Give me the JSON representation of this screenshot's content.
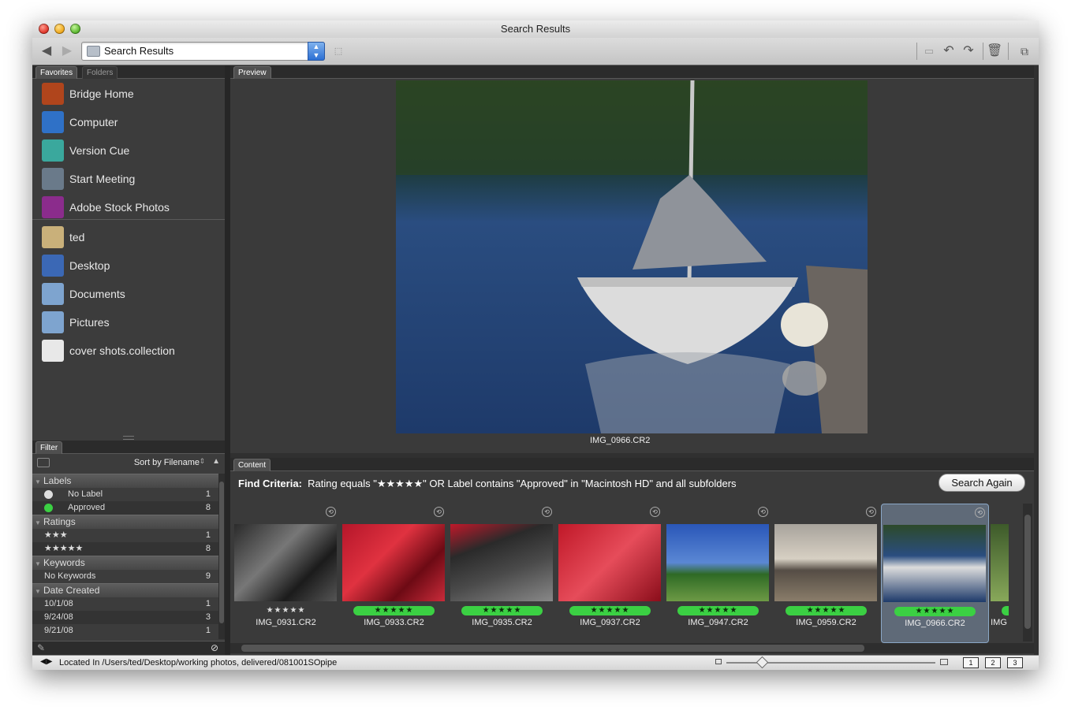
{
  "window": {
    "title": "Search Results"
  },
  "toolbar": {
    "path": "Search Results"
  },
  "left_tabs": {
    "favorites": "Favorites",
    "folders": "Folders"
  },
  "favorites": [
    {
      "label": "Bridge Home",
      "icon": "bridge-home-icon",
      "color": "#b0451c"
    },
    {
      "label": "Computer",
      "icon": "computer-icon",
      "color": "#2f71c7"
    },
    {
      "label": "Version Cue",
      "icon": "version-cue-icon",
      "color": "#3aa89d"
    },
    {
      "label": "Start Meeting",
      "icon": "start-meeting-icon",
      "color": "#6a7a8a"
    },
    {
      "label": "Adobe Stock Photos",
      "icon": "adobe-stock-photos-icon",
      "color": "#8b2c8c"
    },
    {
      "label": "ted",
      "icon": "home-folder-icon",
      "color": "#c9b07a"
    },
    {
      "label": "Desktop",
      "icon": "desktop-folder-icon",
      "color": "#3b68b5"
    },
    {
      "label": "Documents",
      "icon": "documents-folder-icon",
      "color": "#7ea4cf"
    },
    {
      "label": "Pictures",
      "icon": "pictures-folder-icon",
      "color": "#7ea4cf"
    },
    {
      "label": "cover shots.collection",
      "icon": "collection-icon",
      "color": "#e8e8e8"
    }
  ],
  "filter": {
    "tab": "Filter",
    "sort": "Sort by Filename",
    "groups": [
      {
        "name": "Labels",
        "rows": [
          {
            "label": "No Label",
            "count": "1"
          },
          {
            "label": "Approved",
            "count": "8"
          }
        ]
      },
      {
        "name": "Ratings",
        "rows": [
          {
            "label": "★★★",
            "count": "1"
          },
          {
            "label": "★★★★★",
            "count": "8"
          }
        ]
      },
      {
        "name": "Keywords",
        "rows": [
          {
            "label": "No Keywords",
            "count": "9"
          }
        ]
      },
      {
        "name": "Date Created",
        "rows": [
          {
            "label": "10/1/08",
            "count": "1"
          },
          {
            "label": "9/24/08",
            "count": "3"
          },
          {
            "label": "9/21/08",
            "count": "1"
          }
        ]
      }
    ]
  },
  "preview": {
    "tab": "Preview",
    "caption": "IMG_0966.CR2"
  },
  "content": {
    "tab": "Content",
    "criteria_label": "Find Criteria:",
    "criteria_text": "Rating equals \"★★★★★\" OR Label contains \"Approved\" in \"Macintosh HD\" and all subfolders",
    "search_again": "Search Again",
    "thumbs": [
      {
        "name": "IMG_0931.CR2",
        "rating": "★★★★★",
        "approved": false
      },
      {
        "name": "IMG_0933.CR2",
        "rating": "★★★★★",
        "approved": true
      },
      {
        "name": "IMG_0935.CR2",
        "rating": "★★★★★",
        "approved": true
      },
      {
        "name": "IMG_0937.CR2",
        "rating": "★★★★★",
        "approved": true
      },
      {
        "name": "IMG_0947.CR2",
        "rating": "★★★★★",
        "approved": true
      },
      {
        "name": "IMG_0959.CR2",
        "rating": "★★★★★",
        "approved": true
      },
      {
        "name": "IMG_0966.CR2",
        "rating": "★★★★★",
        "approved": true
      },
      {
        "name": "IMG",
        "rating": "★★",
        "approved": true
      }
    ]
  },
  "status": {
    "location": "Located In /Users/ted/Desktop/working photos, delivered/081001SOpipe",
    "views": [
      "1",
      "2",
      "3"
    ]
  }
}
